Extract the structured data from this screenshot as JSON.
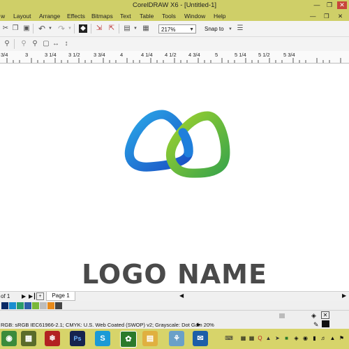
{
  "window": {
    "title": "CorelDRAW X6 - [Untitled-1]"
  },
  "menu": {
    "items": [
      "w",
      "Layout",
      "Arrange",
      "Effects",
      "Bitmaps",
      "Text",
      "Table",
      "Tools",
      "Window",
      "Help"
    ]
  },
  "toolbar": {
    "zoom_value": "217%",
    "snap_label": "Snap to"
  },
  "ruler": {
    "labels": [
      "3/4",
      "3",
      "3 1/4",
      "3 1/2",
      "3 3/4",
      "4",
      "4 1/4",
      "4 1/2",
      "4 3/4",
      "5",
      "5 1/4",
      "5 1/2",
      "5 3/4"
    ]
  },
  "canvas": {
    "logo_text": "LOGO NAME"
  },
  "page_nav": {
    "page_count": "of 1",
    "page_tab": "Page 1"
  },
  "palette": {
    "colors": [
      "#0a2a66",
      "#1a8ed0",
      "#2a9d6a",
      "#2b5ea8",
      "#7ab83a",
      "#bdbdbd",
      "#e88a1a",
      "#444444"
    ]
  },
  "status": {
    "color_profiles": "RGB: sRGB IEC61966-2.1; CMYK: U.S. Web Coated (SWOP) v2; Grayscale: Dot Gain 20%"
  },
  "colors": {
    "titlebar": "#cfcf68",
    "taskbar": "#d7d46a",
    "logo_blue": "#1f6fd6",
    "logo_green": "#6ab834",
    "logo_text": "#4a4a4a"
  },
  "taskbar": {
    "apps": [
      "chrome-icon",
      "calculator-icon",
      "acrobat-icon",
      "photoshop-icon",
      "skype-icon",
      "coreldraw-icon",
      "folder-icon",
      "network-icon",
      "outlook-icon"
    ]
  }
}
